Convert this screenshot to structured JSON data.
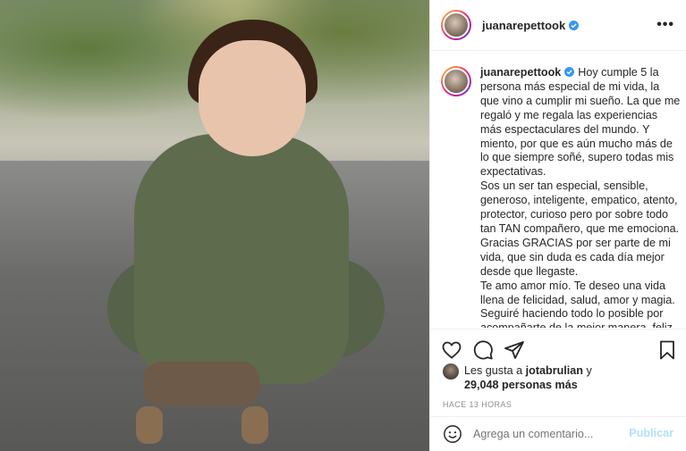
{
  "colors": {
    "accent": "#0095f6",
    "publish_disabled": "#b2dffc",
    "text": "#262626",
    "muted": "#8e8e8e"
  },
  "photo": {
    "alt_icon": "post-photo"
  },
  "header": {
    "username": "juanarepettook",
    "more_label": "•••"
  },
  "caption": {
    "username": "juanarepettook",
    "paragraphs": [
      "Hoy cumple 5 la persona más especial de mi vida, la que vino a cumplir mi sueño. La que me regaló y me regala las experiencias más espectaculares del mundo. Y miento, por que es aún mucho más de lo que siempre soñé, supero todas mis expectativas.",
      "Sos un ser tan especial, sensible, generoso, inteligente, empatico, atento, protector, curioso pero por sobre todo tan TAN compañero, que me emociona. Gracias GRACIAS por ser parte de mi vida, que sin duda es cada día mejor desde que llegaste.",
      "Te amo amor mío. Te deseo una vida llena de felicidad, salud, amor y magia.",
      "Seguiré haciendo todo lo posible por acompañarte de la mejor manera, feliz"
    ]
  },
  "likes": {
    "prefix": "Les gusta a",
    "user": "jotabrulian",
    "conj": "y",
    "count_text": "29,048 personas más"
  },
  "timestamp": "HACE 13 HORAS",
  "comment": {
    "placeholder": "Agrega un comentario...",
    "publish_label": "Publicar"
  }
}
